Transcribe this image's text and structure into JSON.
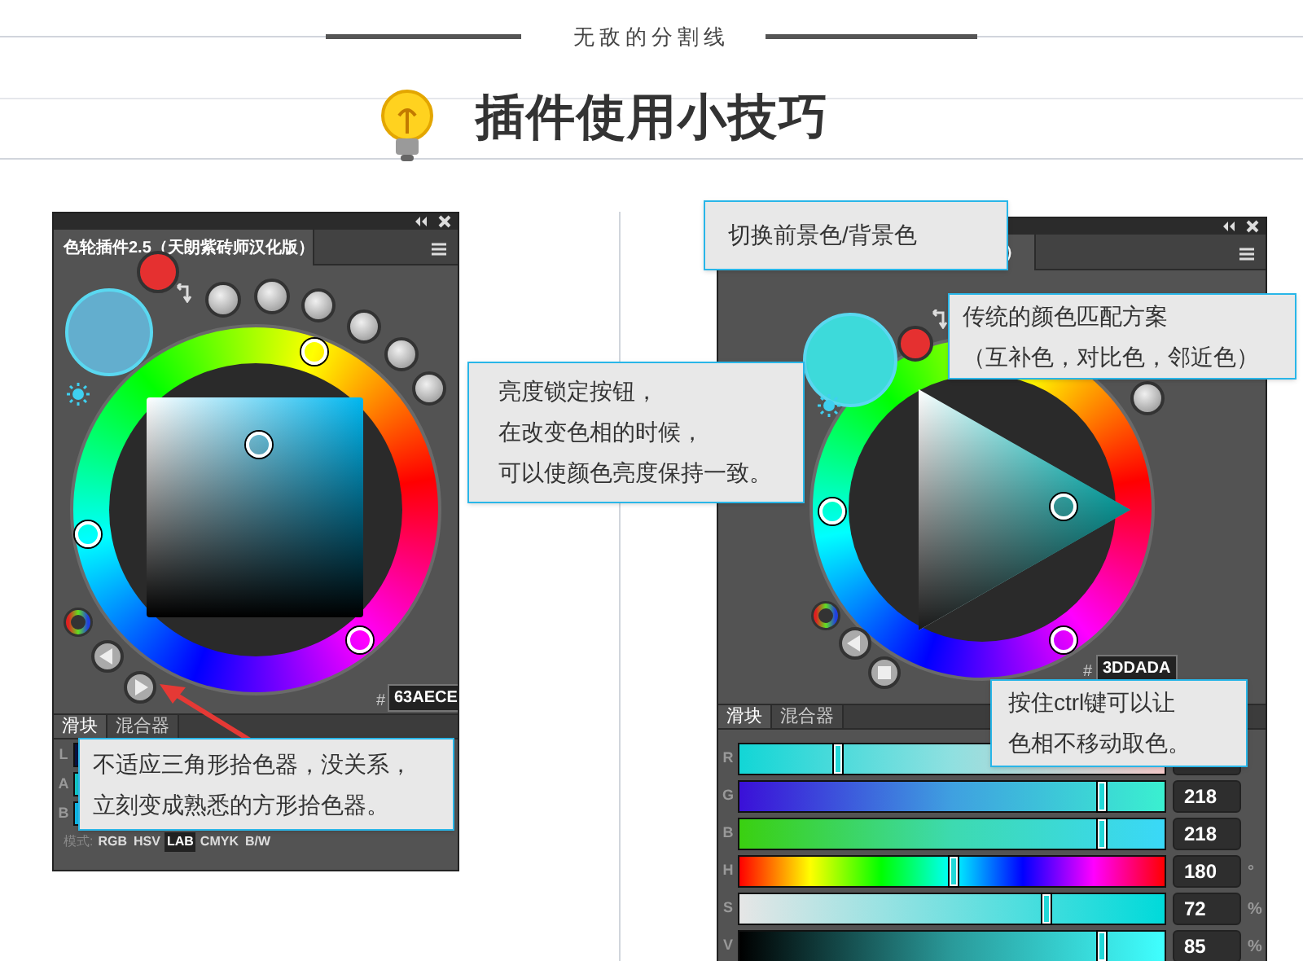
{
  "divider": {
    "label": "无敌的分割线"
  },
  "heading": {
    "title": "插件使用小技巧"
  },
  "left_panel": {
    "tab_label": "色轮插件2.5（天朗紫砖师汉化版）",
    "picker": {
      "kind": "square"
    },
    "hex_sign": "#",
    "hex": "63AECE",
    "tabs": [
      {
        "label": "滑块",
        "selected": true
      },
      {
        "label": "混合器",
        "selected": false
      }
    ],
    "sliders": [
      {
        "label": "L",
        "kind": "lab_l"
      },
      {
        "label": "A",
        "kind": "lab_a"
      },
      {
        "label": "B",
        "kind": "lab_b"
      }
    ],
    "mode_label": "模式:",
    "modes": [
      {
        "label": "RGB",
        "selected": false
      },
      {
        "label": "HSV",
        "selected": false
      },
      {
        "label": "LAB",
        "selected": true
      },
      {
        "label": "CMYK",
        "selected": false
      },
      {
        "label": "B/W",
        "selected": false
      }
    ]
  },
  "right_panel": {
    "tab_label": "）",
    "picker": {
      "kind": "triangle"
    },
    "hex_sign": "#",
    "hex": "3DDADA",
    "tabs": [
      {
        "label": "滑块",
        "selected": true
      },
      {
        "label": "混合器",
        "selected": false
      }
    ],
    "sliders": [
      {
        "label": "R",
        "kind": "r",
        "level": 0.23
      },
      {
        "label": "G",
        "kind": "g",
        "level": 0.85,
        "value": "218"
      },
      {
        "label": "B",
        "kind": "b",
        "level": 0.85,
        "value": "218"
      },
      {
        "label": "H",
        "kind": "h",
        "level": 0.5,
        "value": "180",
        "unit": "°"
      },
      {
        "label": "S",
        "kind": "s",
        "level": 0.72,
        "value": "72",
        "unit": "%"
      },
      {
        "label": "V",
        "kind": "v",
        "level": 0.85,
        "value": "85",
        "unit": "%"
      }
    ]
  },
  "callouts": [
    {
      "lines": [
        "切换前景色/背景色"
      ]
    },
    {
      "lines": [
        "传统的颜色匹配方案",
        "（互补色，对比色，邻近色）"
      ]
    },
    {
      "lines": [
        "亮度锁定按钮，",
        "在改变色相的时候，",
        "可以使颜色亮度保持一致。"
      ]
    },
    {
      "lines": [
        "按住ctrl键可以让",
        "色相不移动取色。"
      ]
    },
    {
      "lines": [
        "不适应三角形拾色器，没关系，",
        "立刻变成熟悉的方形拾色器。"
      ]
    }
  ]
}
